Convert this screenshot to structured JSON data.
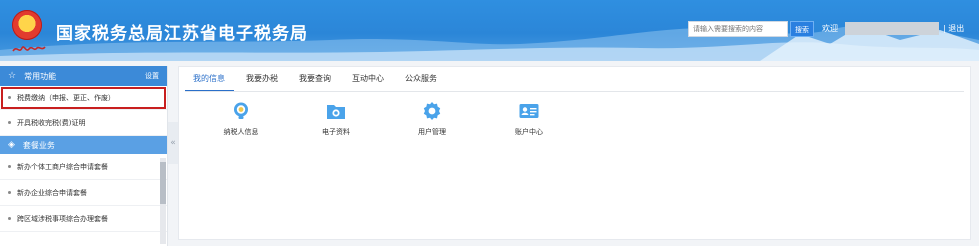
{
  "header": {
    "title": "国家税务总局江苏省电子税务局",
    "search_placeholder": "请输入需要搜索的内容",
    "search_button": "搜索",
    "welcome": "欢迎",
    "logout": "| 退出"
  },
  "sidebar": {
    "common_header": "常用功能",
    "settings_label": "设置",
    "common_items": [
      {
        "label": "税费缴纳（申报、更正、作废）"
      },
      {
        "label": "开具税收完税(费)证明"
      }
    ],
    "package_header": "套餐业务",
    "package_items": [
      {
        "label": "新办个体工商户综合申请套餐"
      },
      {
        "label": "新办企业综合申请套餐"
      },
      {
        "label": "跨区域涉税事项综合办理套餐"
      }
    ],
    "collapse_glyph": "«"
  },
  "main": {
    "tabs": [
      {
        "label": "我的信息"
      },
      {
        "label": "我要办税"
      },
      {
        "label": "我要查询"
      },
      {
        "label": "互动中心"
      },
      {
        "label": "公众服务"
      }
    ],
    "apps": [
      {
        "label": "纳税人信息",
        "icon": "bulb-icon"
      },
      {
        "label": "电子资料",
        "icon": "folder-icon"
      },
      {
        "label": "用户管理",
        "icon": "gear-icon"
      },
      {
        "label": "账户中心",
        "icon": "id-card-icon"
      }
    ]
  },
  "colors": {
    "header_blue": "#2b86d8",
    "sidebar_header": "#3c8ad8",
    "active_tab": "#2a6fc9",
    "highlight_red": "#c81f1f"
  }
}
